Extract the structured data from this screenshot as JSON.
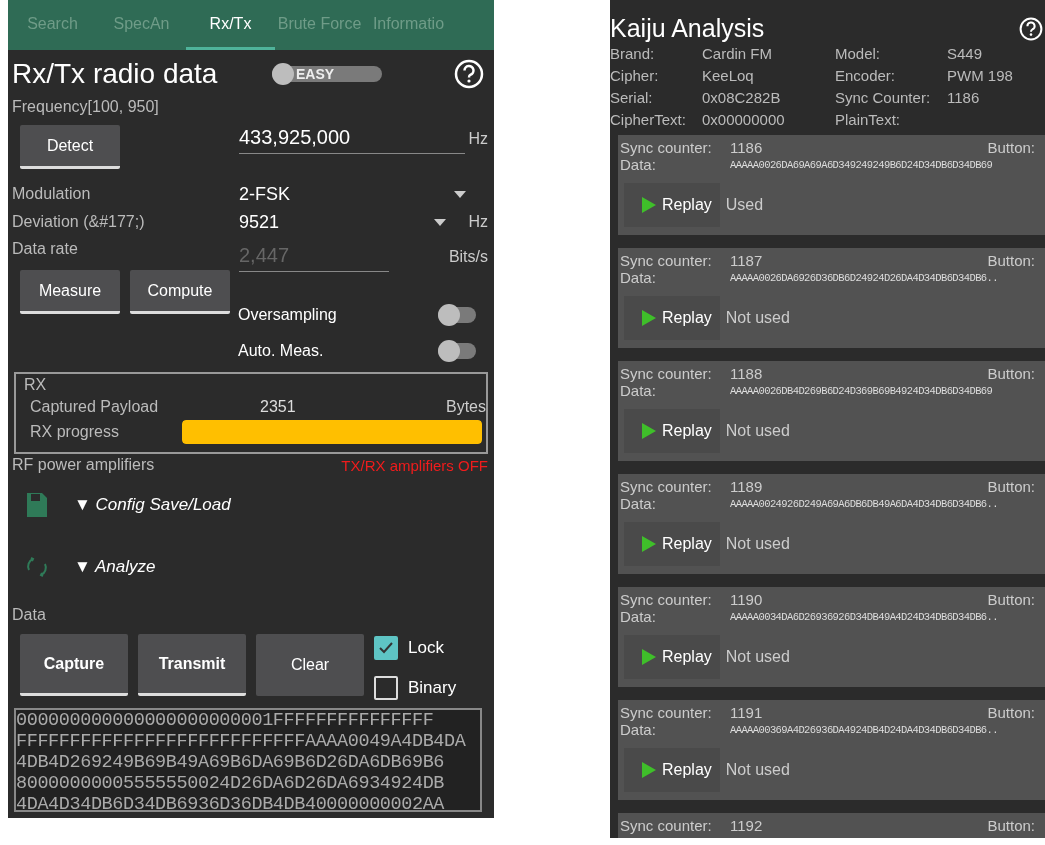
{
  "left": {
    "tabs": [
      {
        "label": "Search",
        "selected": false
      },
      {
        "label": "SpecAn",
        "selected": false
      },
      {
        "label": "Rx/Tx",
        "selected": true
      },
      {
        "label": "Brute Force",
        "selected": false
      },
      {
        "label": "Informatio",
        "selected": false
      }
    ],
    "title": "Rx/Tx radio data",
    "mode_switch": {
      "label": "EASY",
      "on": false
    },
    "frequency": {
      "label": "Frequency[100, 950]",
      "button": "Detect",
      "value": "433,925,000",
      "unit": "Hz"
    },
    "modulation": {
      "label": "Modulation",
      "value": "2-FSK"
    },
    "deviation": {
      "label": "Deviation (&#177;)",
      "value": "9521",
      "unit": "Hz"
    },
    "data_rate": {
      "label": "Data rate",
      "placeholder": "2,447",
      "unit": "Bits/s",
      "buttons": [
        "Measure",
        "Compute"
      ]
    },
    "toggles": [
      {
        "label": "Oversampling",
        "on": false
      },
      {
        "label": "Auto. Meas.",
        "on": false
      }
    ],
    "rx": {
      "title": "RX",
      "payload_label": "Captured Payload",
      "payload_value": "2351",
      "payload_unit": "Bytes",
      "progress_label": "RX progress",
      "level": 1.0
    },
    "rf": {
      "label": "RF power amplifiers",
      "status": "TX/RX amplifiers OFF"
    },
    "sections": [
      {
        "label": "▼ Config Save/Load",
        "kind": "save"
      },
      {
        "label": "▼ Analyze",
        "kind": "analyze"
      }
    ],
    "data": {
      "label": "Data",
      "buttons": [
        "Capture",
        "Transmit",
        "Clear"
      ],
      "checks": [
        {
          "label": "Lock",
          "checked": true
        },
        {
          "label": "Binary",
          "checked": false
        }
      ],
      "lines": [
        "000000000000000000000001FFFFFFFFFFFFFFF",
        "FFFFFFFFFFFFFFFFFFFFFFFFFFFAAAA0049A4DB4DA",
        "4DB4D269249B69B49A69B6DA69B6D26DA6DB69B6",
        "80000000005555550024D26DA6D26DA6934924DB",
        "4DA4D34DB6D34DB6936D36DB4DB40000000002AA"
      ]
    }
  },
  "right": {
    "title": "Kaiju Analysis",
    "info": [
      [
        "Brand:",
        "Cardin FM",
        "Model:",
        "S449"
      ],
      [
        "Cipher:",
        "KeeLoq",
        "Encoder:",
        "PWM 198"
      ],
      [
        "Serial:",
        "0x08C282B",
        "Sync Counter:",
        "1186"
      ],
      [
        "CipherText:",
        "0x00000000",
        "PlainText:"
      ]
    ],
    "records": [
      {
        "sync_label": "Sync counter:",
        "sync": "1186",
        "button_label": "Button:",
        "data_label": "Data:",
        "data": "AAAAA0026DA69A69A6D349249249B6D24D34DB6D34DB69",
        "replay": "Replay",
        "status": "Used"
      },
      {
        "sync_label": "Sync counter:",
        "sync": "1187",
        "button_label": "Button:",
        "data_label": "Data:",
        "data": "AAAAA0026DA6926D36DB6D24924D26DA4D34DB6D34DB6..",
        "replay": "Replay",
        "status": "Not used"
      },
      {
        "sync_label": "Sync counter:",
        "sync": "1188",
        "button_label": "Button:",
        "data_label": "Data:",
        "data": "AAAAA0026DB4D269B6D24D369B69B4924D34DB6D34DB69",
        "replay": "Replay",
        "status": "Not used"
      },
      {
        "sync_label": "Sync counter:",
        "sync": "1189",
        "button_label": "Button:",
        "data_label": "Data:",
        "data": "AAAAA0024926D249A69A6DB6DB49A6DA4D34DB6D34DB6..",
        "replay": "Replay",
        "status": "Not used"
      },
      {
        "sync_label": "Sync counter:",
        "sync": "1190",
        "button_label": "Button:",
        "data_label": "Data:",
        "data": "AAAAA0034DA6D26936926D34DB49A4D24D34DB6D34DB6..",
        "replay": "Replay",
        "status": "Not used"
      },
      {
        "sync_label": "Sync counter:",
        "sync": "1191",
        "button_label": "Button:",
        "data_label": "Data:",
        "data": "AAAAA00369A4D26936DA4924DB4D24DA4D34DB6D34DB6..",
        "replay": "Replay",
        "status": "Not used"
      },
      {
        "sync_label": "Sync counter:",
        "sync": "1192",
        "button_label": "Button:"
      }
    ]
  }
}
